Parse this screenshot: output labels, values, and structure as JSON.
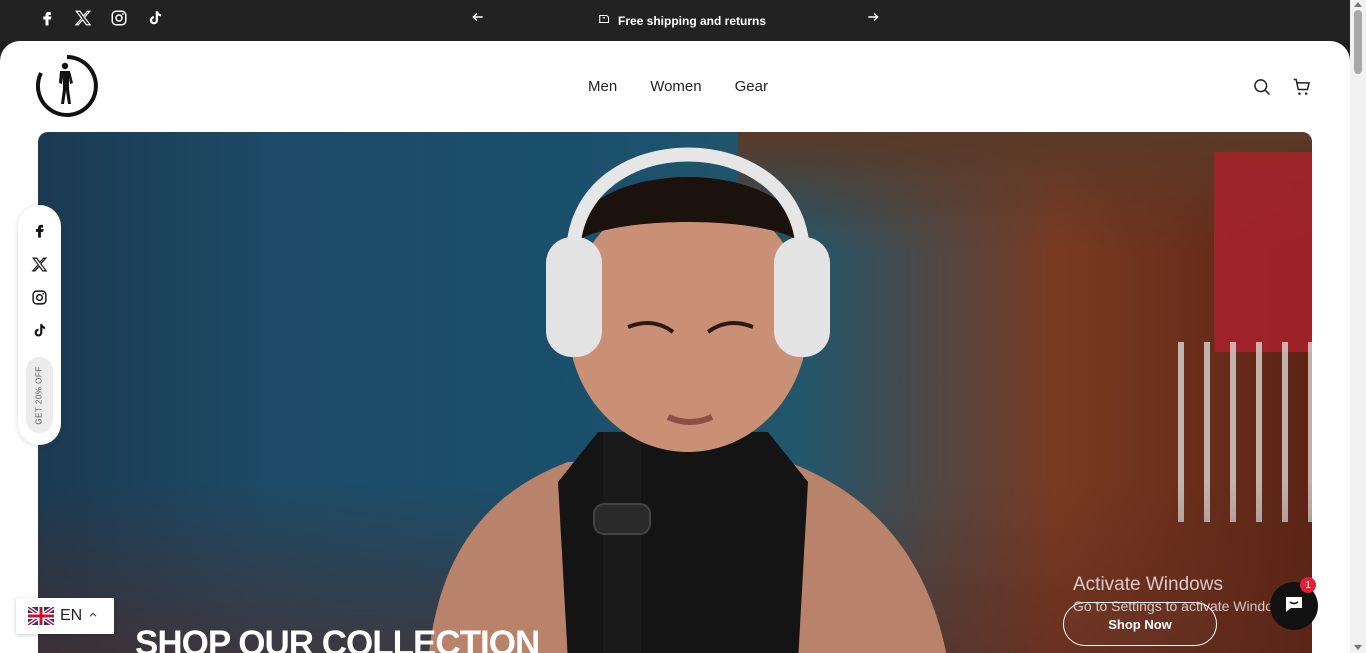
{
  "topbar": {
    "socials": [
      "facebook-icon",
      "x-twitter-icon",
      "instagram-icon",
      "tiktok-icon"
    ],
    "announcement": "Free shipping and returns",
    "background": "#222222"
  },
  "header": {
    "nav": [
      {
        "label": "Men"
      },
      {
        "label": "Women"
      },
      {
        "label": "Gear"
      }
    ],
    "icons": [
      "search-icon",
      "cart-icon"
    ]
  },
  "hero": {
    "headline": "SHOP OUR COLLECTION",
    "cta_label": "Shop Now"
  },
  "side_social": {
    "icons": [
      "facebook-icon",
      "x-twitter-icon",
      "instagram-icon",
      "tiktok-icon"
    ],
    "promo_label": "GET 20% OFF"
  },
  "language": {
    "code": "EN",
    "flag": "uk-flag-icon"
  },
  "watermark": {
    "title": "Activate Windows",
    "subtitle": "Go to Settings to activate Windows."
  },
  "chat": {
    "badge": "1"
  },
  "colors": {
    "accent": "#e0213a",
    "text": "#222222"
  }
}
